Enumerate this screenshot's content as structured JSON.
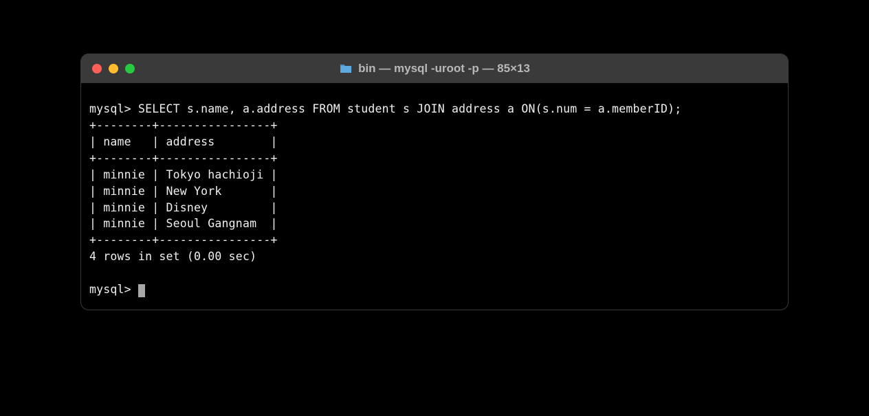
{
  "window": {
    "title": "bin — mysql -uroot -p — 85×13",
    "folder_icon": "folder-icon"
  },
  "terminal": {
    "prompt": "mysql>",
    "query": "SELECT s.name, a.address FROM student s JOIN address a ON(s.num = a.memberID);",
    "divider": "+--------+----------------+",
    "header_row": "| name   | address        |",
    "rows": [
      "| minnie | Tokyo hachioji |",
      "| minnie | New York       |",
      "| minnie | Disney         |",
      "| minnie | Seoul Gangnam  |"
    ],
    "status": "4 rows in set (0.00 sec)",
    "prompt2": "mysql> "
  }
}
